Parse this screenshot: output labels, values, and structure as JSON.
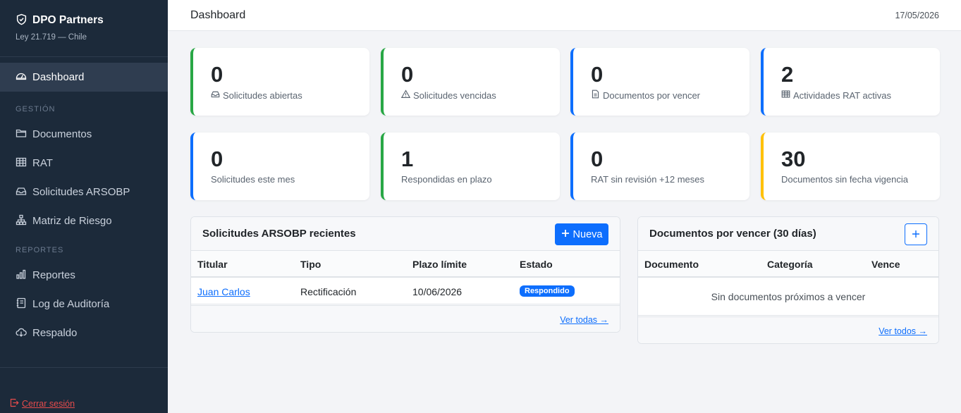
{
  "sidebar": {
    "brand_title": "DPO Partners",
    "brand_sub": "Ley 21.719 — Chile",
    "items": [
      {
        "label": "Dashboard",
        "icon": "gauge-icon"
      },
      {
        "label": "Documentos",
        "icon": "folder-icon"
      },
      {
        "label": "RAT",
        "icon": "table-icon"
      },
      {
        "label": "Solicitudes ARSOBP",
        "icon": "inbox-icon"
      },
      {
        "label": "Matriz de Riesgo",
        "icon": "diagram-icon"
      },
      {
        "label": "Reportes",
        "icon": "bar-chart-icon"
      },
      {
        "label": "Log de Auditoría",
        "icon": "journal-icon"
      },
      {
        "label": "Respaldo",
        "icon": "cloud-download-icon"
      }
    ],
    "sections": {
      "gestion": "GESTIÓN",
      "reportes": "REPORTES"
    },
    "logout": "Cerrar sesión"
  },
  "header": {
    "title": "Dashboard",
    "date": "17/05/2026"
  },
  "stats": [
    {
      "value": "0",
      "label": "Solicitudes abiertas",
      "icon": "inbox-icon",
      "color": "#28a745"
    },
    {
      "value": "0",
      "label": "Solicitudes vencidas",
      "icon": "warning-icon",
      "color": "#28a745"
    },
    {
      "value": "0",
      "label": "Documentos por vencer",
      "icon": "file-icon",
      "color": "#0d6efd"
    },
    {
      "value": "2",
      "label": "Actividades RAT activas",
      "icon": "table-icon",
      "color": "#0d6efd"
    },
    {
      "value": "0",
      "label": "Solicitudes este mes",
      "icon": "",
      "color": "#0d6efd"
    },
    {
      "value": "1",
      "label": "Respondidas en plazo",
      "icon": "",
      "color": "#28a745"
    },
    {
      "value": "0",
      "label": "RAT sin revisión +12 meses",
      "icon": "",
      "color": "#0d6efd"
    },
    {
      "value": "30",
      "label": "Documentos sin fecha vigencia",
      "icon": "",
      "color": "#ffc107"
    }
  ],
  "requests_panel": {
    "title": "Solicitudes ARSOBP recientes",
    "new_label": "Nueva",
    "columns": [
      "Titular",
      "Tipo",
      "Plazo límite",
      "Estado"
    ],
    "rows": [
      {
        "titular": "Juan Carlos",
        "tipo": "Rectificación",
        "plazo": "10/06/2026",
        "estado": "Respondido"
      }
    ],
    "see_all": "Ver todas →"
  },
  "docs_panel": {
    "title": "Documentos por vencer (30 días)",
    "columns": [
      "Documento",
      "Categoría",
      "Vence"
    ],
    "empty": "Sin documentos próximos a vencer",
    "see_all": "Ver todos →"
  }
}
